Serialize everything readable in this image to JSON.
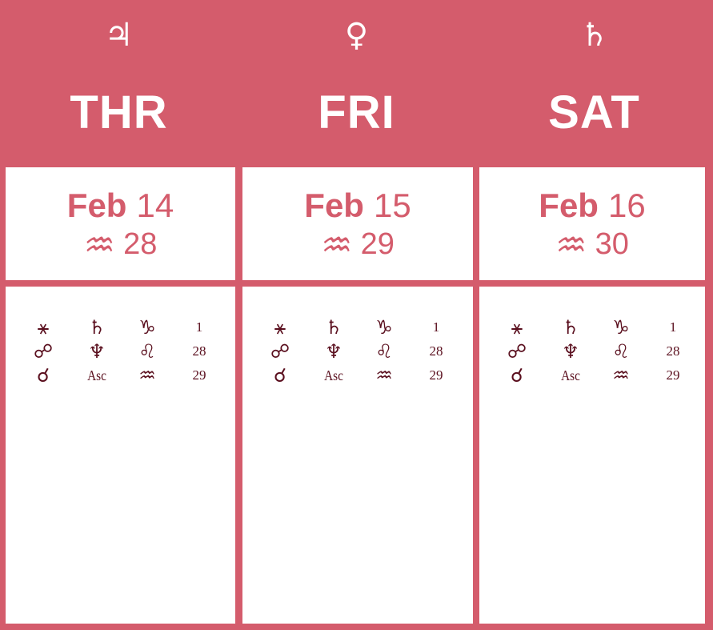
{
  "days": [
    {
      "planet_glyph": "♃",
      "planet_icon": "jupiter-icon",
      "day_name": "THR",
      "month": "Feb",
      "day": "14",
      "sign_glyph": "♒",
      "sign_icon": "aquarius-icon",
      "sign_degree": "28",
      "aspects": [
        {
          "aspect": "⚹",
          "planet": "♄",
          "sign": "♑",
          "degree": "1"
        },
        {
          "aspect": "☍",
          "planet": "♆",
          "sign": "♌",
          "degree": "28"
        },
        {
          "aspect": "☌",
          "planet": "Asc",
          "sign": "♒",
          "degree": "29"
        }
      ]
    },
    {
      "planet_glyph": "♀",
      "planet_icon": "venus-icon",
      "day_name": "FRI",
      "month": "Feb",
      "day": "15",
      "sign_glyph": "♒",
      "sign_icon": "aquarius-icon",
      "sign_degree": "29",
      "aspects": [
        {
          "aspect": "⚹",
          "planet": "♄",
          "sign": "♑",
          "degree": "1"
        },
        {
          "aspect": "☍",
          "planet": "♆",
          "sign": "♌",
          "degree": "28"
        },
        {
          "aspect": "☌",
          "planet": "Asc",
          "sign": "♒",
          "degree": "29"
        }
      ]
    },
    {
      "planet_glyph": "♄",
      "planet_icon": "saturn-icon",
      "day_name": "SAT",
      "month": "Feb",
      "day": "16",
      "sign_glyph": "♒",
      "sign_icon": "aquarius-icon",
      "sign_degree": "30",
      "aspects": [
        {
          "aspect": "⚹",
          "planet": "♄",
          "sign": "♑",
          "degree": "1"
        },
        {
          "aspect": "☍",
          "planet": "♆",
          "sign": "♌",
          "degree": "28"
        },
        {
          "aspect": "☌",
          "planet": "Asc",
          "sign": "♒",
          "degree": "29"
        }
      ]
    }
  ],
  "colors": {
    "accent": "#d45c6c",
    "panel": "#ffffff",
    "glyph_text": "#5a0f1e"
  }
}
